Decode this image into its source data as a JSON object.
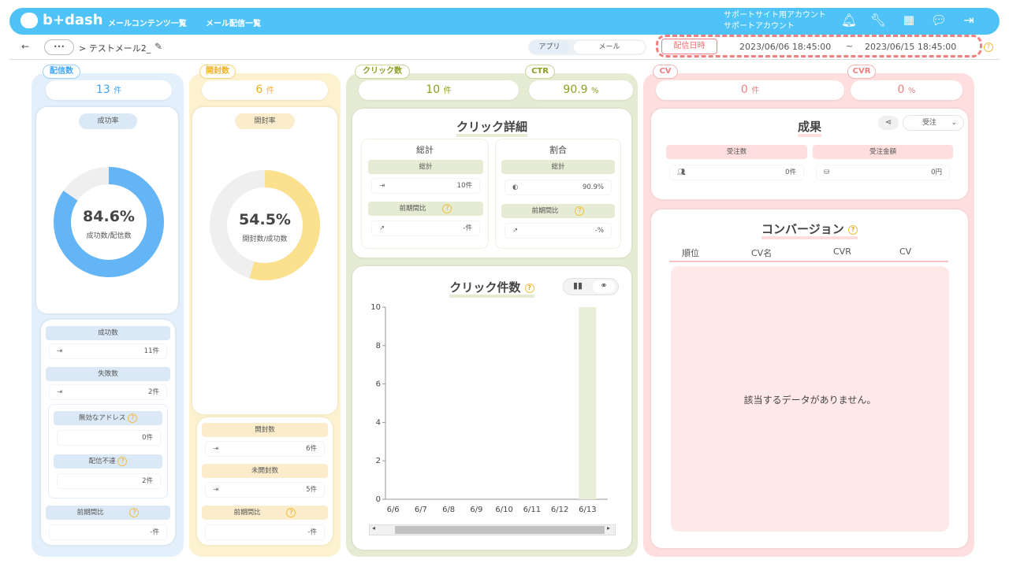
{
  "header": {
    "logo": "b+dash",
    "nav": [
      "メールコンテンツ一覧",
      "メール配信一覧"
    ],
    "account_line1": "サポートサイト用アカウント",
    "account_line2": "サポートアカウント"
  },
  "subbar": {
    "back": "←",
    "dots": "•••",
    "breadcrumb": "> テストメール2_",
    "tab_app": "アプリ",
    "tab_mail": "メール",
    "delivery_label": "配信日時",
    "date_from": "2023/06/06 18:45:00",
    "tilde": "~",
    "date_to": "2023/06/15 18:45:00"
  },
  "delivery": {
    "title": "配信数",
    "count": "13",
    "unit": "件",
    "rate_label": "成功率",
    "percent": "84.6%",
    "sub": "成功数/配信数",
    "pct_value": 84.6,
    "success_label": "成功数",
    "success_val": "11件",
    "fail_label": "失敗数",
    "fail_val": "2件",
    "invalid_label": "無効なアドレス",
    "invalid_val": "0件",
    "undeliv_label": "配信不達",
    "undeliv_val": "2件",
    "prev_label": "前期間比",
    "prev_val": "-件"
  },
  "open": {
    "title": "開封数",
    "count": "6",
    "unit": "件",
    "rate_label": "開封率",
    "percent": "54.5%",
    "sub": "開封数/成功数",
    "pct_value": 54.5,
    "open_label": "開封数",
    "open_val": "6件",
    "unopen_label": "未開封数",
    "unopen_val": "5件",
    "prev_label": "前期間比",
    "prev_val": "-件"
  },
  "click": {
    "title": "クリック数",
    "count": "10",
    "unit": "件",
    "ctr_title": "CTR",
    "ctr": "90.9",
    "ctr_unit": "%",
    "detail_title": "クリック詳細",
    "total_title": "総計",
    "ratio_title": "割合",
    "total_h": "総計",
    "total_val": "10件",
    "prev_h": "前期間比",
    "prev_val": "-件",
    "ratio_h": "総計",
    "ratio_val": "90.9%",
    "ratio_prev_h": "前期間比",
    "ratio_prev_val": "-%",
    "chart_title": "クリック件数"
  },
  "cv": {
    "title": "CV",
    "count": "0",
    "unit": "件",
    "cvr_title": "CVR",
    "cvr": "0",
    "cvr_unit": "%",
    "result_title": "成果",
    "select": "受注",
    "orders_h": "受注数",
    "orders_val": "0件",
    "amount_h": "受注金額",
    "amount_val": "0円",
    "conv_title": "コンバージョン",
    "cols": [
      "順位",
      "CV名",
      "CVR",
      "CV"
    ],
    "empty": "該当するデータがありません。"
  },
  "chart_data": {
    "type": "bar",
    "categories": [
      "6/6",
      "6/7",
      "6/8",
      "6/9",
      "6/10",
      "6/11",
      "6/12",
      "6/13"
    ],
    "values": [
      0,
      0,
      0,
      0,
      0,
      0,
      0,
      10
    ],
    "yticks": [
      "0",
      "2",
      "4",
      "6",
      "8",
      "10"
    ],
    "ylim": [
      0,
      10
    ],
    "color": "#e8eed8"
  },
  "colors": {
    "blue": "#64b5f6",
    "yellow": "#fbe08e",
    "green": "#e6ecd4",
    "pink": "#ffcdd2"
  }
}
